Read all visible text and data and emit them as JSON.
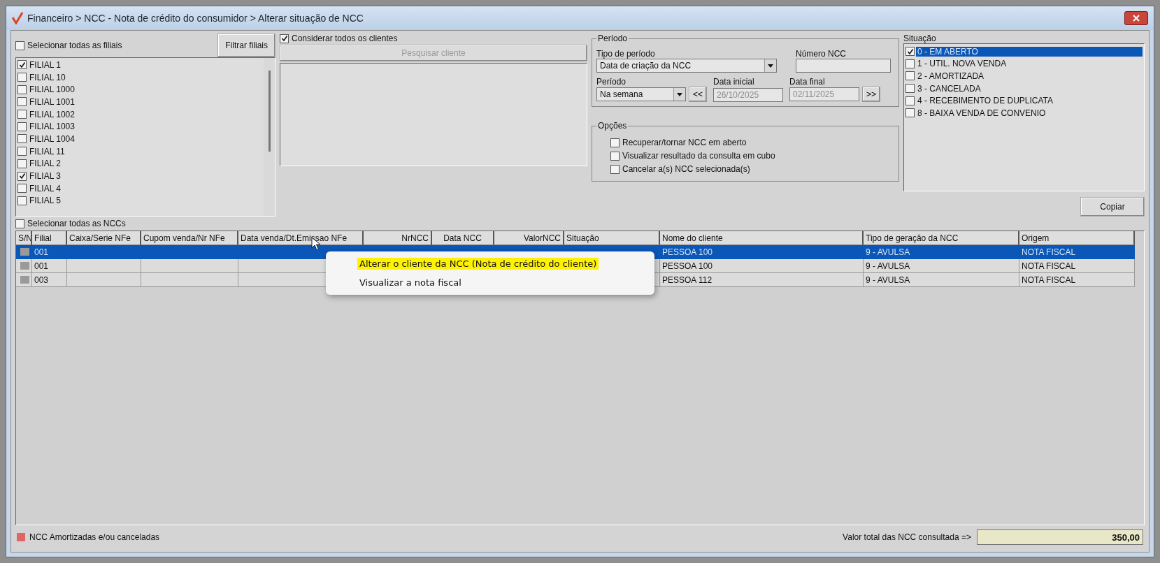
{
  "window": {
    "title": "Financeiro > NCC - Nota de crédito do consumidor > Alterar situação de NCC"
  },
  "branches": {
    "select_all": {
      "label": "Selecionar todas as filiais",
      "checked": false
    },
    "filter_button": "Filtrar filiais",
    "items": [
      {
        "label": "FILIAL 1",
        "checked": true
      },
      {
        "label": "FILIAL 10",
        "checked": false
      },
      {
        "label": "FILIAL 1000",
        "checked": false
      },
      {
        "label": "FILIAL 1001",
        "checked": false
      },
      {
        "label": "FILIAL 1002",
        "checked": false
      },
      {
        "label": "FILIAL 1003",
        "checked": false
      },
      {
        "label": "FILIAL 1004",
        "checked": false
      },
      {
        "label": "FILIAL 11",
        "checked": false
      },
      {
        "label": "FILIAL 2",
        "checked": false
      },
      {
        "label": "FILIAL 3",
        "checked": true
      },
      {
        "label": "FILIAL 4",
        "checked": false
      },
      {
        "label": "FILIAL 5",
        "checked": false
      }
    ]
  },
  "clients": {
    "consider_all": {
      "label": "Considerar todos os clientes",
      "checked": true
    },
    "search_button": {
      "label": "Pesquisar cliente",
      "disabled": true
    }
  },
  "period": {
    "title": "Período",
    "type_label": "Tipo de período",
    "type_value": "Data de criação da NCC",
    "number_label": "Número NCC",
    "period_label": "Período",
    "period_value": "Na semana",
    "prev_button": "<<",
    "start_label": "Data inicial",
    "start_value": "26/10/2025",
    "end_label": "Data final",
    "end_value": "02/11/2025",
    "next_button": ">>",
    "dates_disabled": true
  },
  "options": {
    "title": "Opções",
    "items": [
      {
        "label": "Recuperar/tornar NCC em aberto",
        "checked": false
      },
      {
        "label": "Visualizar resultado da consulta em cubo",
        "checked": false
      },
      {
        "label": "Cancelar a(s) NCC selecionada(s)",
        "checked": false
      }
    ]
  },
  "status": {
    "title": "Situação",
    "items": [
      {
        "label": "0 - EM ABERTO",
        "checked": true,
        "selected": true
      },
      {
        "label": "1 - UTIL. NOVA VENDA",
        "checked": false,
        "selected": false
      },
      {
        "label": "2 - AMORTIZADA",
        "checked": false,
        "selected": false
      },
      {
        "label": "3 - CANCELADA",
        "checked": false,
        "selected": false
      },
      {
        "label": "4 - RECEBIMENTO DE DUPLICATA",
        "checked": false,
        "selected": false
      },
      {
        "label": "8 - BAIXA VENDA DE CONVENIO",
        "checked": false,
        "selected": false
      }
    ]
  },
  "copy_button": "Copiar",
  "select_all_ncc": {
    "label": "Selecionar todas as NCCs",
    "checked": false
  },
  "table": {
    "columns": [
      {
        "label": "S/N"
      },
      {
        "label": "Filial"
      },
      {
        "label": "Caixa/Serie NFe"
      },
      {
        "label": "Cupom venda/Nr NFe"
      },
      {
        "label": "Data venda/Dt.Emissao NFe"
      },
      {
        "label": "NrNCC"
      },
      {
        "label": "Data NCC"
      },
      {
        "label": "ValorNCC"
      },
      {
        "label": "Situação"
      },
      {
        "label": "Nome do cliente"
      },
      {
        "label": "Tipo de geração da NCC"
      },
      {
        "label": "Origem"
      }
    ],
    "rows": [
      {
        "selected": true,
        "cells": [
          "",
          "001",
          "",
          "",
          "",
          "",
          "",
          "",
          "",
          "PESSOA 100",
          "9 - AVULSA",
          "NOTA FISCAL"
        ]
      },
      {
        "selected": false,
        "cells": [
          "",
          "001",
          "",
          "",
          "",
          "",
          "",
          "",
          "",
          "PESSOA 100",
          "9 - AVULSA",
          "NOTA FISCAL"
        ]
      },
      {
        "selected": false,
        "cells": [
          "",
          "003",
          "",
          "",
          "",
          "",
          "",
          "",
          "",
          "PESSOA 112",
          "9 - AVULSA",
          "NOTA FISCAL"
        ]
      }
    ]
  },
  "context_menu": {
    "items": [
      {
        "label": "Alterar o cliente da NCC (Nota de crédito do cliente)",
        "highlighted": true
      },
      {
        "label": "Visualizar a nota fiscal",
        "highlighted": false
      }
    ]
  },
  "legend": {
    "label": "NCC Amortizadas e/ou canceladas",
    "color": "#e06666"
  },
  "total": {
    "label": "Valor total das NCC consultada =>",
    "value": "350,00"
  }
}
